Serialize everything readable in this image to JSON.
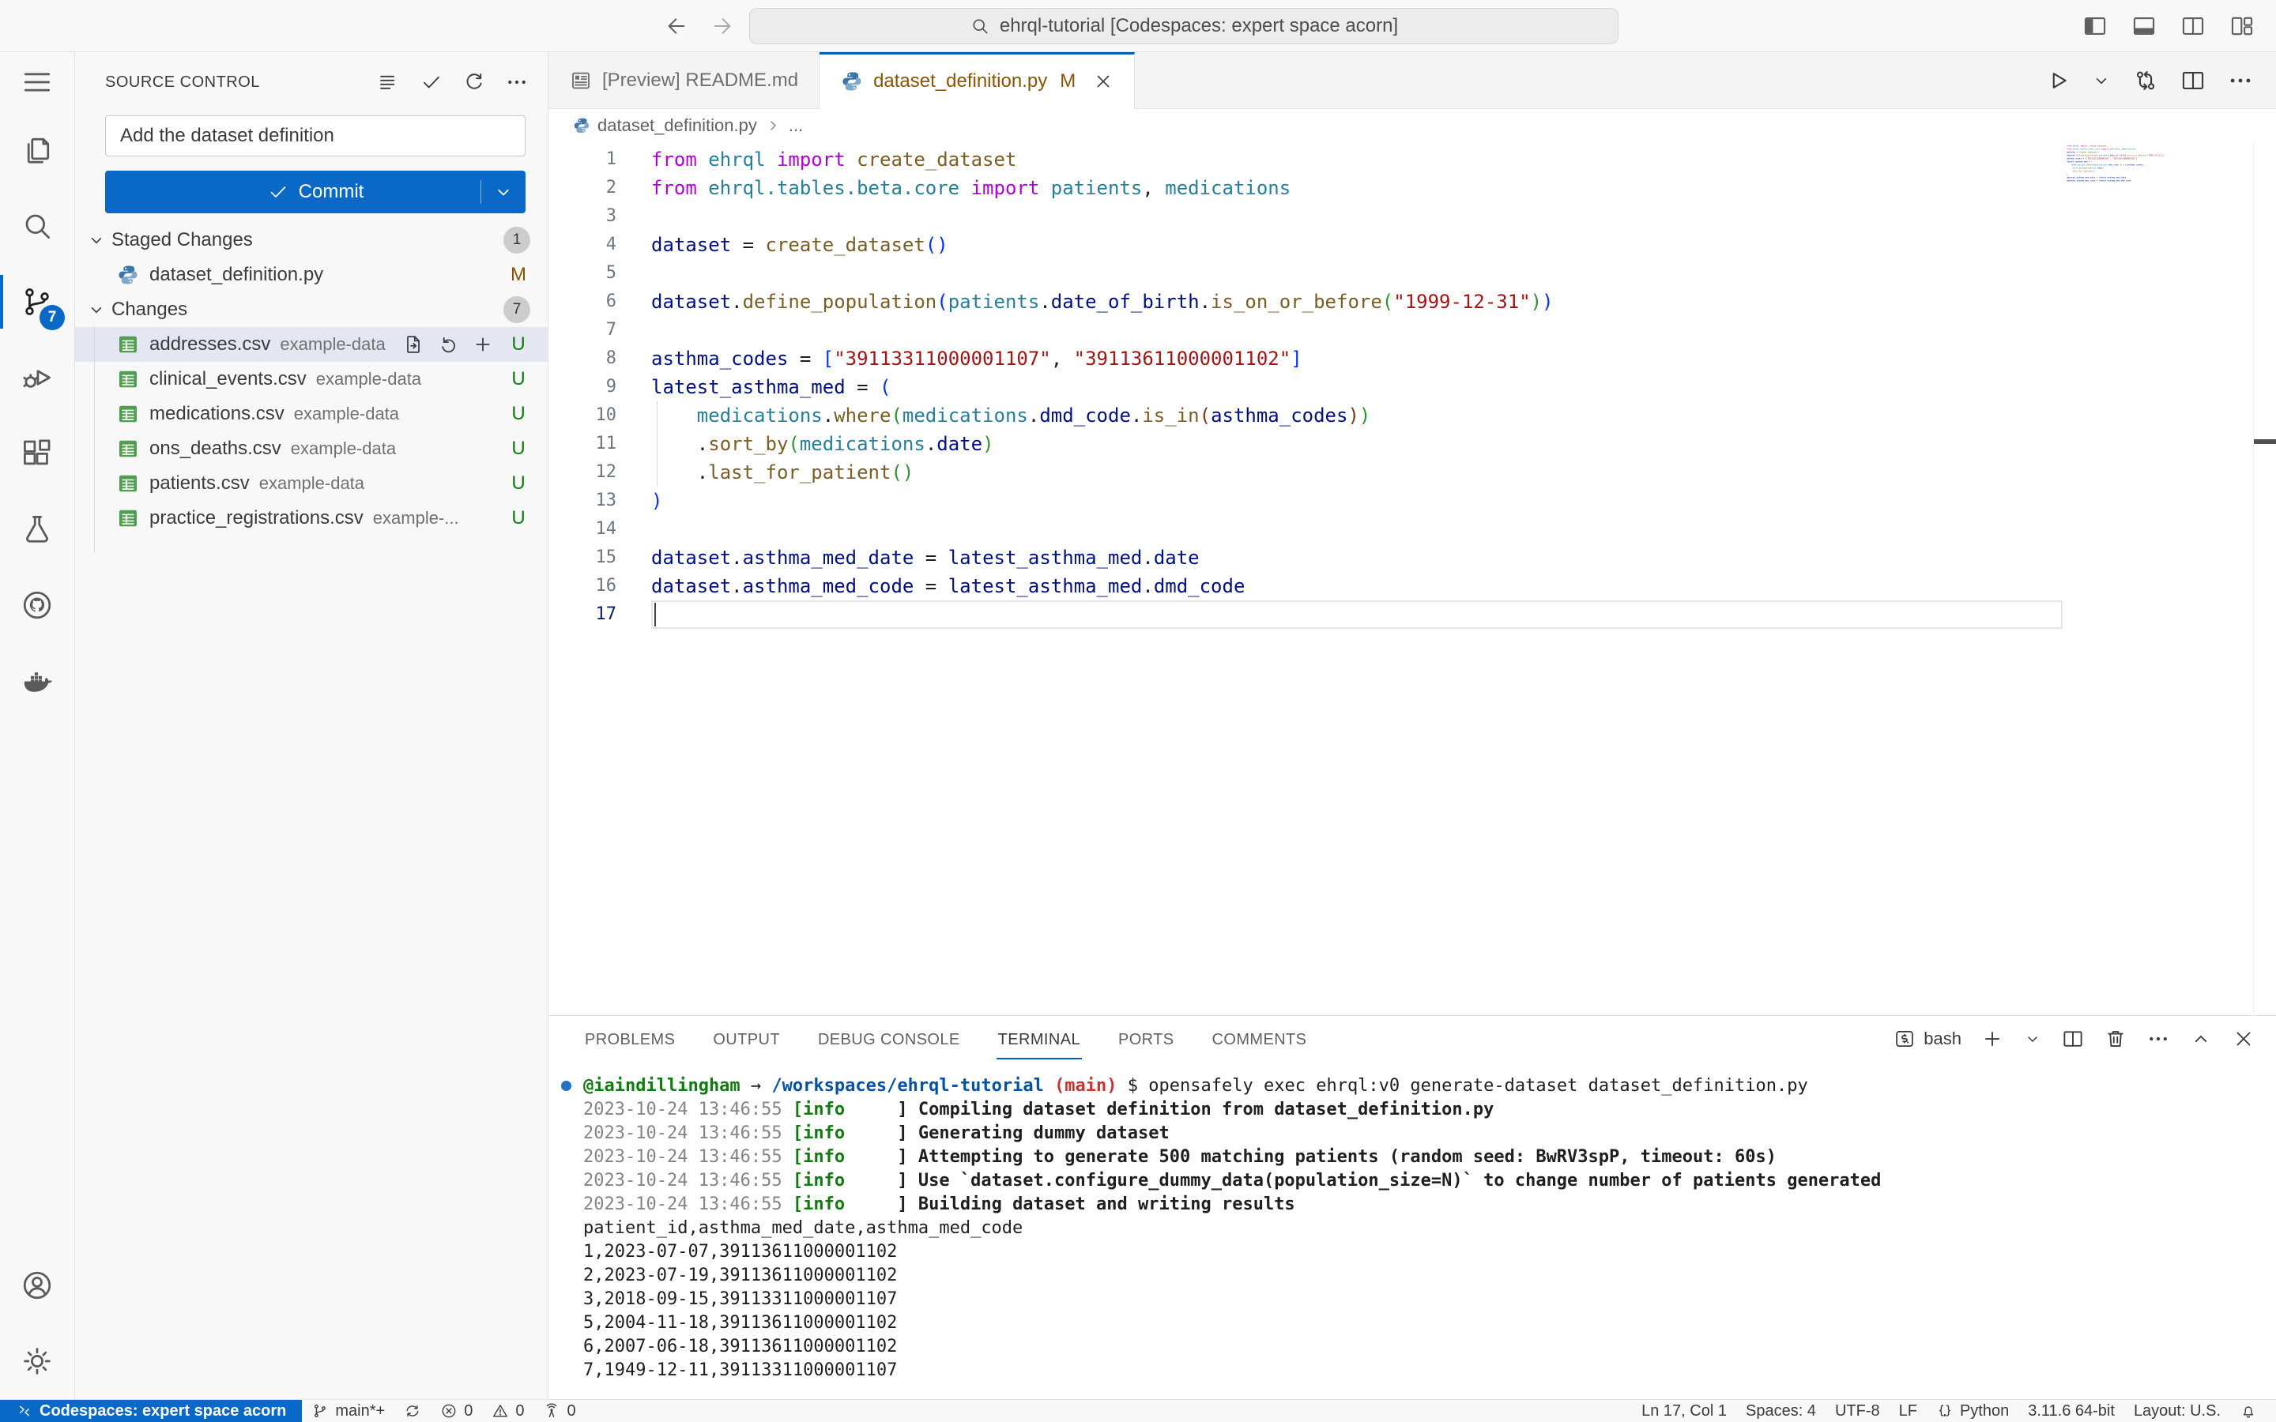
{
  "colors": {
    "accent_blue": "#0A69C6",
    "tab_accent": "#005FB8",
    "badge_blue": "#0A69C6",
    "untracked_green": "#107C10",
    "modified_gold": "#895503",
    "selection_bg": "#E4E6F1",
    "code_keyword": "#AF00DB",
    "code_type": "#267F99",
    "code_function": "#795E26",
    "code_variable": "#001080",
    "code_string": "#A31515",
    "terminal_green": "#107C10",
    "terminal_blue": "#0451A5",
    "terminal_red": "#CD3131",
    "prompt_dot": "#2472C8"
  },
  "title_bar": {
    "search_text": "ehrql-tutorial [Codespaces: expert space acorn]",
    "window_icons": [
      {
        "id": "toggle-sidebar",
        "icon": "layout-sidebar-icon"
      },
      {
        "id": "toggle-panel",
        "icon": "layout-panel-icon"
      },
      {
        "id": "split-editor-layout",
        "icon": "layout-split-icon"
      },
      {
        "id": "customize-layout",
        "icon": "layout-grid-icon"
      }
    ]
  },
  "activity_bar": {
    "items": [
      {
        "id": "menu",
        "icon": "menu-icon"
      },
      {
        "id": "explorer",
        "icon": "explorer-icon"
      },
      {
        "id": "search",
        "icon": "search-icon"
      },
      {
        "id": "source-control",
        "icon": "source-control-icon",
        "badge": "7",
        "active": true
      },
      {
        "id": "run-debug",
        "icon": "debug-icon"
      },
      {
        "id": "extensions",
        "icon": "extensions-icon"
      },
      {
        "id": "testing",
        "icon": "beaker-icon"
      },
      {
        "id": "github",
        "icon": "github-icon"
      },
      {
        "id": "docker",
        "icon": "docker-icon"
      }
    ],
    "bottom_items": [
      {
        "id": "account",
        "icon": "account-icon"
      },
      {
        "id": "settings",
        "icon": "gear-icon"
      }
    ]
  },
  "sidebar": {
    "title": "SOURCE CONTROL",
    "actions": [
      {
        "id": "view-as-list",
        "icon": "list-icon"
      },
      {
        "id": "commit-action",
        "icon": "check-icon"
      },
      {
        "id": "refresh",
        "icon": "refresh-icon"
      },
      {
        "id": "more-actions",
        "icon": "ellipsis-icon"
      }
    ],
    "commit_input": "Add the dataset definition",
    "commit_button": "Commit",
    "sections": [
      {
        "id": "staged",
        "label": "Staged Changes",
        "badge": "1",
        "guide": false,
        "files": [
          {
            "icon": "python-icon",
            "name": "dataset_definition.py",
            "desc": "",
            "status": "M",
            "status_type": "modified"
          }
        ]
      },
      {
        "id": "changes",
        "label": "Changes",
        "badge": "7",
        "guide": true,
        "files": [
          {
            "icon": "csv-icon",
            "name": "addresses.csv",
            "desc": "example-data",
            "status": "U",
            "status_type": "untracked",
            "selected": true,
            "actions": [
              {
                "id": "open-file",
                "icon": "go-to-file-icon"
              },
              {
                "id": "discard-changes",
                "icon": "discard-icon"
              },
              {
                "id": "stage-changes",
                "icon": "plus-icon"
              }
            ]
          },
          {
            "icon": "csv-icon",
            "name": "clinical_events.csv",
            "desc": "example-data",
            "status": "U",
            "status_type": "untracked"
          },
          {
            "icon": "csv-icon",
            "name": "medications.csv",
            "desc": "example-data",
            "status": "U",
            "status_type": "untracked"
          },
          {
            "icon": "csv-icon",
            "name": "ons_deaths.csv",
            "desc": "example-data",
            "status": "U",
            "status_type": "untracked"
          },
          {
            "icon": "csv-icon",
            "name": "patients.csv",
            "desc": "example-data",
            "status": "U",
            "status_type": "untracked"
          },
          {
            "icon": "csv-icon",
            "name": "practice_registrations.csv",
            "desc": "example-...",
            "status": "U",
            "status_type": "untracked"
          }
        ]
      }
    ]
  },
  "editor": {
    "tabs": [
      {
        "id": "readme-preview",
        "icon": "markdown-preview-icon",
        "label": "[Preview] README.md",
        "active": false
      },
      {
        "id": "dataset-definition",
        "icon": "python-icon",
        "label": "dataset_definition.py",
        "modified": "M",
        "active": true,
        "closable": true
      }
    ],
    "actions": [
      {
        "id": "run",
        "icon": "play-icon"
      },
      {
        "id": "run-dropdown",
        "icon": "chevron-down-icon",
        "small": true
      },
      {
        "id": "open-changes",
        "icon": "compare-icon"
      },
      {
        "id": "split-editor",
        "icon": "split-icon"
      },
      {
        "id": "more-actions",
        "icon": "ellipsis-icon"
      }
    ],
    "breadcrumb": {
      "file": "dataset_definition.py",
      "symbol": "..."
    },
    "current_line": 17,
    "code": [
      {
        "n": 1,
        "tokens": [
          [
            "k",
            "from"
          ],
          [
            "p",
            " "
          ],
          [
            "t",
            "ehrql"
          ],
          [
            "p",
            " "
          ],
          [
            "k",
            "import"
          ],
          [
            "p",
            " "
          ],
          [
            "f",
            "create_dataset"
          ]
        ]
      },
      {
        "n": 2,
        "tokens": [
          [
            "k",
            "from"
          ],
          [
            "p",
            " "
          ],
          [
            "t",
            "ehrql.tables.beta.core"
          ],
          [
            "p",
            " "
          ],
          [
            "k",
            "import"
          ],
          [
            "p",
            " "
          ],
          [
            "t",
            "patients"
          ],
          [
            "p",
            ", "
          ],
          [
            "t",
            "medications"
          ]
        ]
      },
      {
        "n": 3,
        "tokens": []
      },
      {
        "n": 4,
        "tokens": [
          [
            "v",
            "dataset"
          ],
          [
            "p",
            " = "
          ],
          [
            "f",
            "create_dataset"
          ],
          [
            "b1",
            "()"
          ]
        ]
      },
      {
        "n": 5,
        "tokens": []
      },
      {
        "n": 6,
        "tokens": [
          [
            "v",
            "dataset"
          ],
          [
            "p",
            "."
          ],
          [
            "f",
            "define_population"
          ],
          [
            "b1",
            "("
          ],
          [
            "t",
            "patients"
          ],
          [
            "p",
            "."
          ],
          [
            "v",
            "date_of_birth"
          ],
          [
            "p",
            "."
          ],
          [
            "f",
            "is_on_or_before"
          ],
          [
            "b2",
            "("
          ],
          [
            "s",
            "\"1999-12-31\""
          ],
          [
            "b2",
            ")"
          ],
          [
            "b1",
            ")"
          ]
        ]
      },
      {
        "n": 7,
        "tokens": []
      },
      {
        "n": 8,
        "tokens": [
          [
            "v",
            "asthma_codes"
          ],
          [
            "p",
            " = "
          ],
          [
            "b1",
            "["
          ],
          [
            "s",
            "\"39113311000001107\""
          ],
          [
            "p",
            ", "
          ],
          [
            "s",
            "\"39113611000001102\""
          ],
          [
            "b1",
            "]"
          ]
        ]
      },
      {
        "n": 9,
        "tokens": [
          [
            "v",
            "latest_asthma_med"
          ],
          [
            "p",
            " = "
          ],
          [
            "b1",
            "("
          ]
        ]
      },
      {
        "n": 10,
        "tokens": [
          [
            "p",
            "    "
          ],
          [
            "t",
            "medications"
          ],
          [
            "p",
            "."
          ],
          [
            "f",
            "where"
          ],
          [
            "b2",
            "("
          ],
          [
            "t",
            "medications"
          ],
          [
            "p",
            "."
          ],
          [
            "v",
            "dmd_code"
          ],
          [
            "p",
            "."
          ],
          [
            "f",
            "is_in"
          ],
          [
            "b3",
            "("
          ],
          [
            "v",
            "asthma_codes"
          ],
          [
            "b3",
            ")"
          ],
          [
            "b2",
            ")"
          ]
        ]
      },
      {
        "n": 11,
        "tokens": [
          [
            "p",
            "    ."
          ],
          [
            "f",
            "sort_by"
          ],
          [
            "b2",
            "("
          ],
          [
            "t",
            "medications"
          ],
          [
            "p",
            "."
          ],
          [
            "v",
            "date"
          ],
          [
            "b2",
            ")"
          ]
        ]
      },
      {
        "n": 12,
        "tokens": [
          [
            "p",
            "    ."
          ],
          [
            "f",
            "last_for_patient"
          ],
          [
            "b2",
            "()"
          ]
        ]
      },
      {
        "n": 13,
        "tokens": [
          [
            "b1",
            ")"
          ]
        ]
      },
      {
        "n": 14,
        "tokens": []
      },
      {
        "n": 15,
        "tokens": [
          [
            "v",
            "dataset"
          ],
          [
            "p",
            "."
          ],
          [
            "v",
            "asthma_med_date"
          ],
          [
            "p",
            " = "
          ],
          [
            "v",
            "latest_asthma_med"
          ],
          [
            "p",
            "."
          ],
          [
            "v",
            "date"
          ]
        ]
      },
      {
        "n": 16,
        "tokens": [
          [
            "v",
            "dataset"
          ],
          [
            "p",
            "."
          ],
          [
            "v",
            "asthma_med_code"
          ],
          [
            "p",
            " = "
          ],
          [
            "v",
            "latest_asthma_med"
          ],
          [
            "p",
            "."
          ],
          [
            "v",
            "dmd_code"
          ]
        ]
      },
      {
        "n": 17,
        "tokens": []
      }
    ]
  },
  "panel": {
    "tabs": [
      "PROBLEMS",
      "OUTPUT",
      "DEBUG CONSOLE",
      "TERMINAL",
      "PORTS",
      "COMMENTS"
    ],
    "active_tab": "TERMINAL",
    "shell_label": "bash",
    "actions": [
      {
        "id": "new-terminal",
        "icon": "plus-icon"
      },
      {
        "id": "terminal-dropdown",
        "icon": "chevron-down-icon",
        "small": true
      },
      {
        "id": "split-terminal",
        "icon": "split-icon"
      },
      {
        "id": "kill-terminal",
        "icon": "trash-icon"
      },
      {
        "id": "more-actions",
        "icon": "ellipsis-icon"
      },
      {
        "id": "maximize-panel",
        "icon": "chevron-up-icon"
      },
      {
        "id": "close-panel",
        "icon": "close-icon"
      }
    ],
    "terminal_lines": [
      {
        "dot": true,
        "segs": [
          [
            "user",
            "@iaindillingham"
          ],
          [
            "p",
            " → "
          ],
          [
            "path",
            "/workspaces/ehrql-tutorial"
          ],
          [
            "p",
            " "
          ],
          [
            "branch",
            "(main)"
          ],
          [
            "p",
            " $ opensafely exec ehrql:v0 generate-dataset dataset_definition.py"
          ]
        ]
      },
      {
        "segs": [
          [
            "dim",
            "2023-10-24 13:46:55 "
          ],
          [
            "info",
            "[info"
          ],
          [
            "b",
            "     ] Compiling dataset definition from dataset_definition.py"
          ]
        ]
      },
      {
        "segs": [
          [
            "dim",
            "2023-10-24 13:46:55 "
          ],
          [
            "info",
            "[info"
          ],
          [
            "b",
            "     ] Generating dummy dataset"
          ]
        ]
      },
      {
        "segs": [
          [
            "dim",
            "2023-10-24 13:46:55 "
          ],
          [
            "info",
            "[info"
          ],
          [
            "b",
            "     ] Attempting to generate 500 matching patients (random seed: BwRV3spP, timeout: 60s)"
          ]
        ]
      },
      {
        "segs": [
          [
            "dim",
            "2023-10-24 13:46:55 "
          ],
          [
            "info",
            "[info"
          ],
          [
            "b",
            "     ] Use `dataset.configure_dummy_data(population_size=N)` to change number of patients generated"
          ]
        ]
      },
      {
        "segs": [
          [
            "dim",
            "2023-10-24 13:46:55 "
          ],
          [
            "info",
            "[info"
          ],
          [
            "b",
            "     ] Building dataset and writing results"
          ]
        ]
      },
      {
        "segs": [
          [
            "p",
            "patient_id,asthma_med_date,asthma_med_code"
          ]
        ]
      },
      {
        "segs": [
          [
            "p",
            "1,2023-07-07,39113611000001102"
          ]
        ]
      },
      {
        "segs": [
          [
            "p",
            "2,2023-07-19,39113611000001102"
          ]
        ]
      },
      {
        "segs": [
          [
            "p",
            "3,2018-09-15,39113311000001107"
          ]
        ]
      },
      {
        "segs": [
          [
            "p",
            "5,2004-11-18,39113611000001102"
          ]
        ]
      },
      {
        "segs": [
          [
            "p",
            "6,2007-06-18,39113611000001102"
          ]
        ]
      },
      {
        "segs": [
          [
            "p",
            "7,1949-12-11,39113311000001107"
          ]
        ]
      }
    ]
  },
  "status_bar": {
    "left": [
      {
        "id": "remote",
        "icon": "remote-icon",
        "text": "Codespaces: expert space acorn",
        "remote": true
      },
      {
        "id": "branch",
        "icon": "branch-icon",
        "text": "main*+"
      },
      {
        "id": "sync",
        "icon": "sync-icon",
        "text": ""
      },
      {
        "id": "errors",
        "icon": "error-icon",
        "text": "0"
      },
      {
        "id": "warnings",
        "icon": "warning-icon",
        "text": "0"
      },
      {
        "id": "ports",
        "icon": "broadcast-icon",
        "text": "0"
      }
    ],
    "right": [
      {
        "id": "cursor-position",
        "text": "Ln 17, Col 1"
      },
      {
        "id": "indentation",
        "text": "Spaces: 4"
      },
      {
        "id": "encoding",
        "text": "UTF-8"
      },
      {
        "id": "eol",
        "text": "LF"
      },
      {
        "id": "language",
        "icon": "braces-icon",
        "text": "Python"
      },
      {
        "id": "python-version",
        "text": "3.11.6 64-bit"
      },
      {
        "id": "keyboard-layout",
        "text": "Layout: U.S."
      },
      {
        "id": "notifications",
        "icon": "bell-icon",
        "text": ""
      }
    ]
  }
}
